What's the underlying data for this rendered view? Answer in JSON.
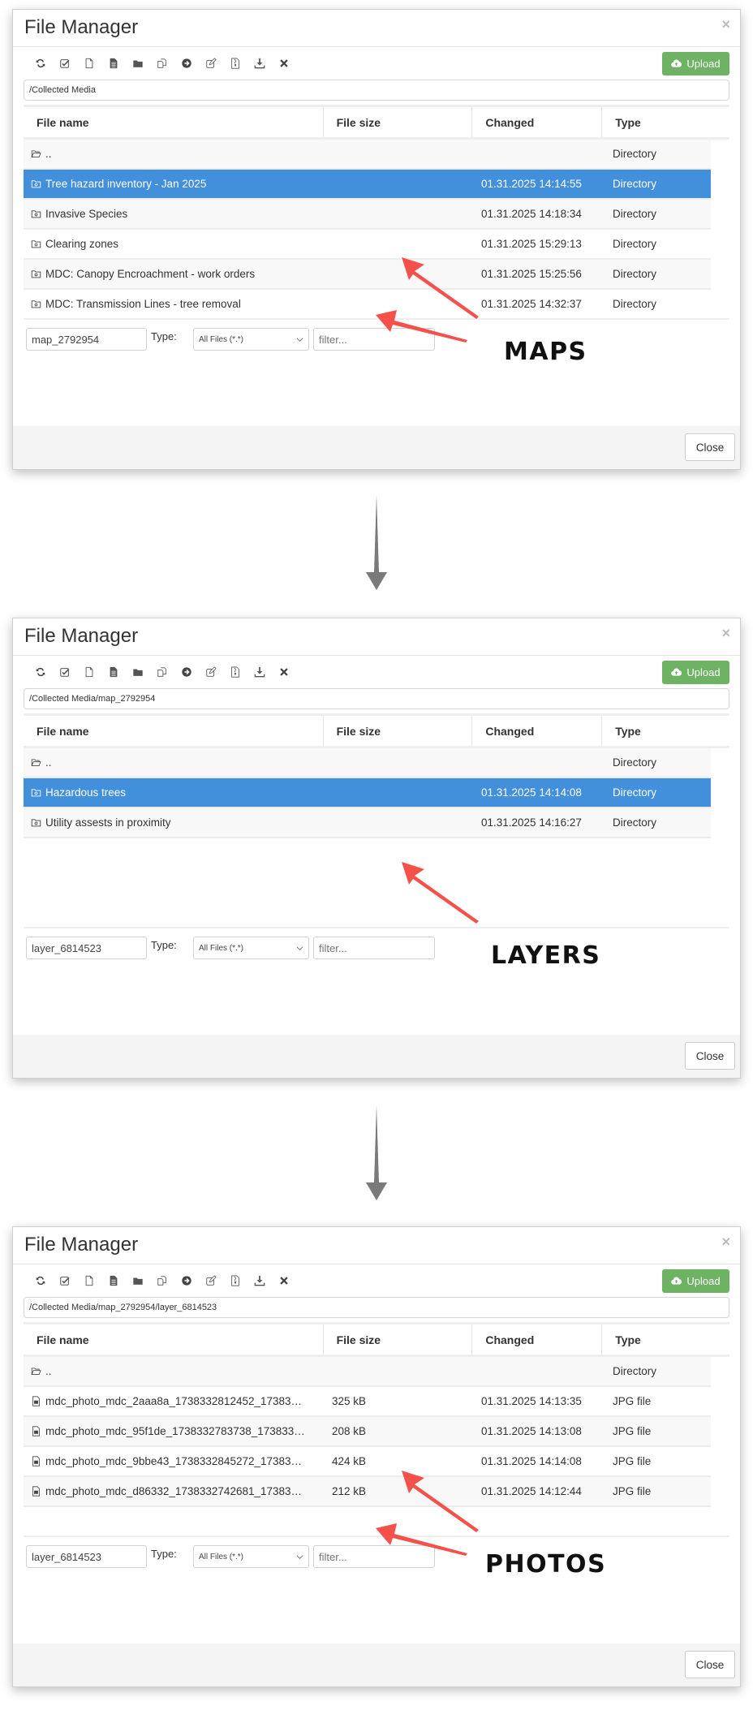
{
  "colors": {
    "selected_row": "#428fdb",
    "upload_button": "#6db363",
    "annotation_arrow": "#f4514a",
    "step_arrow": "#7a7a7a"
  },
  "toolbar_icons": [
    "refresh-icon",
    "check-square-icon",
    "new-file-icon",
    "file-text-icon",
    "folder-icon",
    "copy-icon",
    "move-arrow-icon",
    "edit-icon",
    "zip-file-icon",
    "download-icon",
    "delete-icon"
  ],
  "panels": [
    {
      "title": "File Manager",
      "close_x": "×",
      "upload_label": "Upload",
      "path": "/Collected Media",
      "columns": [
        "File name",
        "File size",
        "Changed",
        "Type"
      ],
      "rows": [
        {
          "icon": "folder-open-icon",
          "name": "..",
          "size": "",
          "changed": "",
          "type": "Directory",
          "selected": false
        },
        {
          "icon": "folder-icon",
          "name": "Tree hazard inventory - Jan 2025",
          "size": "",
          "changed": "01.31.2025 14:14:55",
          "type": "Directory",
          "selected": true
        },
        {
          "icon": "folder-icon",
          "name": "Invasive Species",
          "size": "",
          "changed": "01.31.2025 14:18:34",
          "type": "Directory",
          "selected": false
        },
        {
          "icon": "folder-icon",
          "name": "Clearing zones",
          "size": "",
          "changed": "01.31.2025 15:29:13",
          "type": "Directory",
          "selected": false
        },
        {
          "icon": "folder-icon",
          "name": "MDC: Canopy Encroachment - work orders",
          "size": "",
          "changed": "01.31.2025 15:25:56",
          "type": "Directory",
          "selected": false
        },
        {
          "icon": "folder-icon",
          "name": "MDC: Transmission Lines - tree removal",
          "size": "",
          "changed": "01.31.2025 14:32:37",
          "type": "Directory",
          "selected": false
        }
      ],
      "filename_value": "map_2792954",
      "type_label": "Type:",
      "type_selected": "All Files (*.*)",
      "filter_placeholder": "filter...",
      "close_label": "Close",
      "annotation": "MAPS"
    },
    {
      "title": "File Manager",
      "close_x": "×",
      "upload_label": "Upload",
      "path": "/Collected Media/map_2792954",
      "columns": [
        "File name",
        "File size",
        "Changed",
        "Type"
      ],
      "rows": [
        {
          "icon": "folder-open-icon",
          "name": "..",
          "size": "",
          "changed": "",
          "type": "Directory",
          "selected": false
        },
        {
          "icon": "folder-icon",
          "name": "Hazardous trees",
          "size": "",
          "changed": "01.31.2025 14:14:08",
          "type": "Directory",
          "selected": true
        },
        {
          "icon": "folder-icon",
          "name": "Utility assests in proximity",
          "size": "",
          "changed": "01.31.2025 14:16:27",
          "type": "Directory",
          "selected": false
        }
      ],
      "filename_value": "layer_6814523",
      "type_label": "Type:",
      "type_selected": "All Files (*.*)",
      "filter_placeholder": "filter...",
      "close_label": "Close",
      "annotation": "LAYERS"
    },
    {
      "title": "File Manager",
      "close_x": "×",
      "upload_label": "Upload",
      "path": "/Collected Media/map_2792954/layer_6814523",
      "columns": [
        "File name",
        "File size",
        "Changed",
        "Type"
      ],
      "rows": [
        {
          "icon": "folder-open-icon",
          "name": "..",
          "size": "",
          "changed": "",
          "type": "Directory",
          "selected": false
        },
        {
          "icon": "image-file-icon",
          "name": "mdc_photo_mdc_2aaa8a_1738332812452_17383…",
          "size": "325 kB",
          "changed": "01.31.2025 14:13:35",
          "type": "JPG file",
          "selected": false
        },
        {
          "icon": "image-file-icon",
          "name": "mdc_photo_mdc_95f1de_1738332783738_173833…",
          "size": "208 kB",
          "changed": "01.31.2025 14:13:08",
          "type": "JPG file",
          "selected": false
        },
        {
          "icon": "image-file-icon",
          "name": "mdc_photo_mdc_9bbe43_1738332845272_17383…",
          "size": "424 kB",
          "changed": "01.31.2025 14:14:08",
          "type": "JPG file",
          "selected": false
        },
        {
          "icon": "image-file-icon",
          "name": "mdc_photo_mdc_d86332_1738332742681_17383…",
          "size": "212 kB",
          "changed": "01.31.2025 14:12:44",
          "type": "JPG file",
          "selected": false
        }
      ],
      "filename_value": "layer_6814523",
      "type_label": "Type:",
      "type_selected": "All Files (*.*)",
      "filter_placeholder": "filter...",
      "close_label": "Close",
      "annotation": "PHOTOS"
    }
  ]
}
